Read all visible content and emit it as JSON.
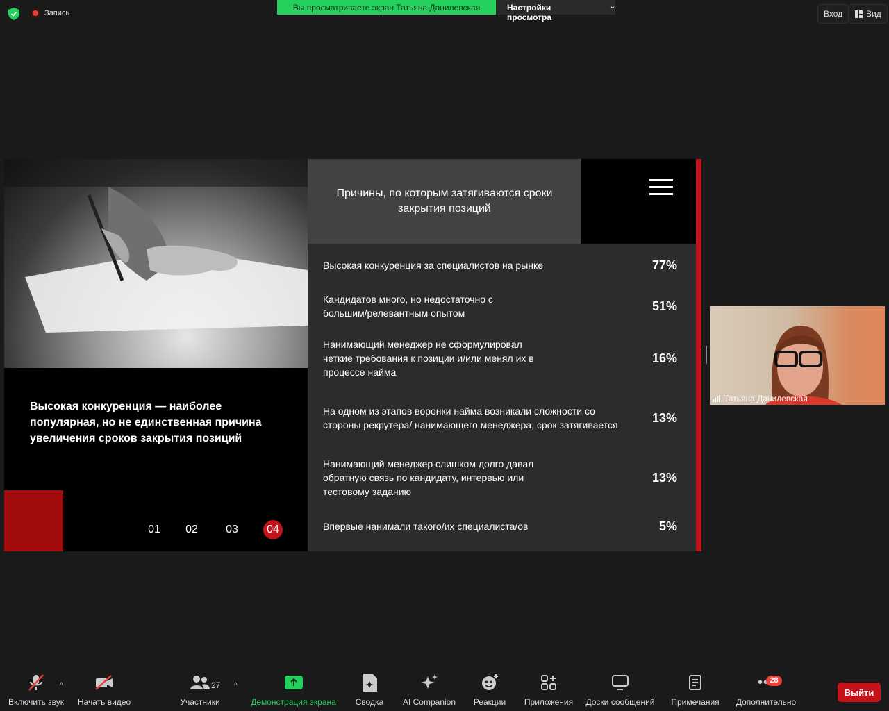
{
  "topbar": {
    "recording_label": "Запись",
    "viewing_banner": "Вы просматриваете экран Татьяна Данилевская",
    "view_settings": "Настройки просмотра",
    "enter_label": "Вход",
    "view_label": "Вид",
    "icons": [
      "shield-icon",
      "record-icon",
      "chevron-down-icon",
      "grid-icon"
    ]
  },
  "slide": {
    "left_text": "Высокая конкуренция — наиболее популярная, но не единственная причина увеличения сроков закрытия позиций",
    "title": "Причины, по которым затягиваются сроки закрытия позиций",
    "pages": [
      "01",
      "02",
      "03",
      "04"
    ],
    "active_page": "04",
    "rows": [
      {
        "label": "Высокая конкуренция за специалистов на рынке",
        "value": "77%"
      },
      {
        "label": "Кандидатов много, но недостаточно с большим/релевантным опытом",
        "value": "51%"
      },
      {
        "label": "Нанимающий менеджер не сформулировал четкие требования к позиции и/или менял их в процессе найма",
        "value": "16%"
      },
      {
        "label": "На одном из этапов воронки найма возникали сложности со стороны рекрутера/ нанимающего менеджера, срок затягивается",
        "value": "13%"
      },
      {
        "label": "Нанимающий менеджер слишком долго давал обратную связь по кандидату, интервью или тестовому заданию",
        "value": "13%"
      },
      {
        "label": "Впервые нанимали такого/их специалиста/ов",
        "value": "5%"
      }
    ],
    "accent_color": "#c0141c"
  },
  "camera": {
    "participant_name": "Татьяна Данилевская"
  },
  "toolbar": {
    "unmute": "Включить звук",
    "start_video": "Начать видео",
    "participants": "Участники",
    "participants_count": "27",
    "share_screen": "Демонстрация экрана",
    "summary": "Сводка",
    "ai_companion": "AI Companion",
    "reactions": "Реакции",
    "apps": "Приложения",
    "whiteboards": "Доски сообщений",
    "notes": "Примечания",
    "more": "Дополнительно",
    "more_badge": "28",
    "leave": "Выйти"
  }
}
